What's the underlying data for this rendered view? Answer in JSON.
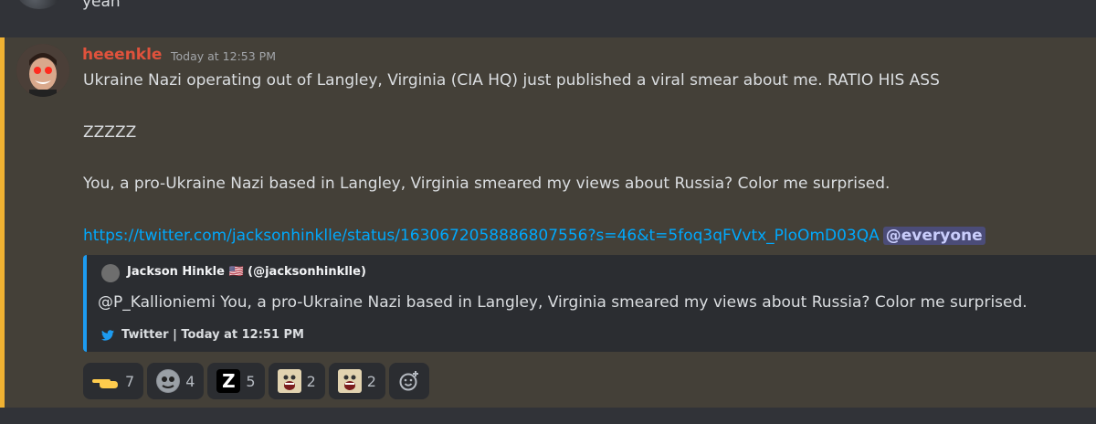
{
  "previous_message": {
    "text": "yeah"
  },
  "message": {
    "author": "heeenkle",
    "timestamp": "Today at 12:53 PM",
    "lines": [
      "Ukraine Nazi operating out of Langley, Virginia (CIA HQ) just published a viral smear about me. RATIO HIS ASS",
      "ZZZZZ",
      "You, a pro-Ukraine Nazi based in Langley, Virginia smeared my views about Russia? Color me surprised."
    ],
    "link": "https://twitter.com/jacksonhinklle/status/1630672058886807556?s=46&t=5foq3qFVvtx_PloOmD03QA",
    "mention": "@everyone",
    "colors": {
      "author": "#e0523c",
      "highlight_bg": "#444038",
      "highlight_border": "#f0b232",
      "link": "#00a8fc"
    }
  },
  "embed": {
    "author": "Jackson Hinkle 🇺🇸 (@jacksonhinklle)",
    "description": "@P_Kallioniemi You, a pro-Ukraine Nazi based in Langley, Virginia smeared my views about Russia? Color me surprised.",
    "footer": "Twitter | Today at 12:51 PM",
    "accent_color": "#1d9bf0"
  },
  "reactions": [
    {
      "icon": "pointing-hand-icon",
      "count": "7"
    },
    {
      "icon": "blob-creature-icon",
      "count": "4"
    },
    {
      "icon": "letter-z-icon",
      "count": "5",
      "glyph": "Z"
    },
    {
      "icon": "screaming-face-icon",
      "count": "2"
    },
    {
      "icon": "screaming-face-icon",
      "count": "2"
    }
  ],
  "add_reaction_icon": "add-reaction-icon"
}
